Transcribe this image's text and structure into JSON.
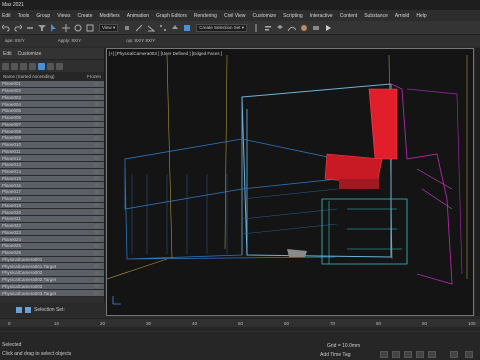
{
  "window": {
    "title": "Max 2021"
  },
  "menu": [
    "Edit",
    "Tools",
    "Group",
    "Views",
    "Create",
    "Modifiers",
    "Animation",
    "Graph Editors",
    "Rendering",
    "Civil View",
    "Customize",
    "Scripting",
    "Interactive",
    "Content",
    "Substance",
    "Arnold",
    "Help"
  ],
  "toolbar": {
    "view_dropdown": "View",
    "selection_set": "Create Selection Set"
  },
  "toolbar2": {
    "left": "ape: 8X/Y",
    "middle": "Apply: 8X/Y",
    "right": "ojs: 8X/Y 8X/Y"
  },
  "scene_explorer": {
    "tabs": [
      "Edit",
      "Customize"
    ],
    "header_name": "Name (Sorted Ascending)",
    "header_frozen": "Frozen",
    "rows": [
      {
        "name": "Plane001",
        "selected": true
      },
      {
        "name": "Plane002",
        "selected": true
      },
      {
        "name": "Plane003",
        "selected": true
      },
      {
        "name": "Plane004",
        "selected": true
      },
      {
        "name": "Plane005",
        "selected": true
      },
      {
        "name": "Plane006",
        "selected": true
      },
      {
        "name": "Plane007",
        "selected": true
      },
      {
        "name": "Plane008",
        "selected": true
      },
      {
        "name": "Plane009",
        "selected": true
      },
      {
        "name": "Plane010",
        "selected": true
      },
      {
        "name": "Plane011",
        "selected": true
      },
      {
        "name": "Plane012",
        "selected": true
      },
      {
        "name": "Plane013",
        "selected": true
      },
      {
        "name": "Plane014",
        "selected": true
      },
      {
        "name": "Plane015",
        "selected": true
      },
      {
        "name": "Plane016",
        "selected": true
      },
      {
        "name": "Plane017",
        "selected": true
      },
      {
        "name": "Plane018",
        "selected": true
      },
      {
        "name": "Plane019",
        "selected": true
      },
      {
        "name": "Plane020",
        "selected": true
      },
      {
        "name": "Plane021",
        "selected": true
      },
      {
        "name": "Plane022",
        "selected": true
      },
      {
        "name": "Plane023",
        "selected": true
      },
      {
        "name": "Plane024",
        "selected": true
      },
      {
        "name": "Plane025",
        "selected": true
      },
      {
        "name": "Plane026",
        "selected": true
      },
      {
        "name": "PhysicalCamera001",
        "selected": true
      },
      {
        "name": "PhysicalCamera001.Target",
        "selected": true
      },
      {
        "name": "PhysicalCamera002",
        "selected": true
      },
      {
        "name": "PhysicalCamera002.Target",
        "selected": true
      },
      {
        "name": "PhysicalCamera003",
        "selected": true
      },
      {
        "name": "PhysicalCamera003.Target",
        "selected": true
      }
    ],
    "footer": "Selection Set:"
  },
  "viewport": {
    "label": "[+] [PhysicalCamera003 ] [User Defined ] [Edged Faces ]"
  },
  "timeline": {
    "ticks": [
      "0",
      "10",
      "20",
      "30",
      "40",
      "50",
      "60",
      "70",
      "80",
      "90",
      "100"
    ]
  },
  "status": {
    "selected": "Selected",
    "prompt": "Click and drag to select objects",
    "grid": "Grid = 10.0mm",
    "add_time_tag": "Add Time Tag"
  },
  "colors": {
    "selection": "#5a5f68",
    "viewport_bg": "#141414"
  }
}
